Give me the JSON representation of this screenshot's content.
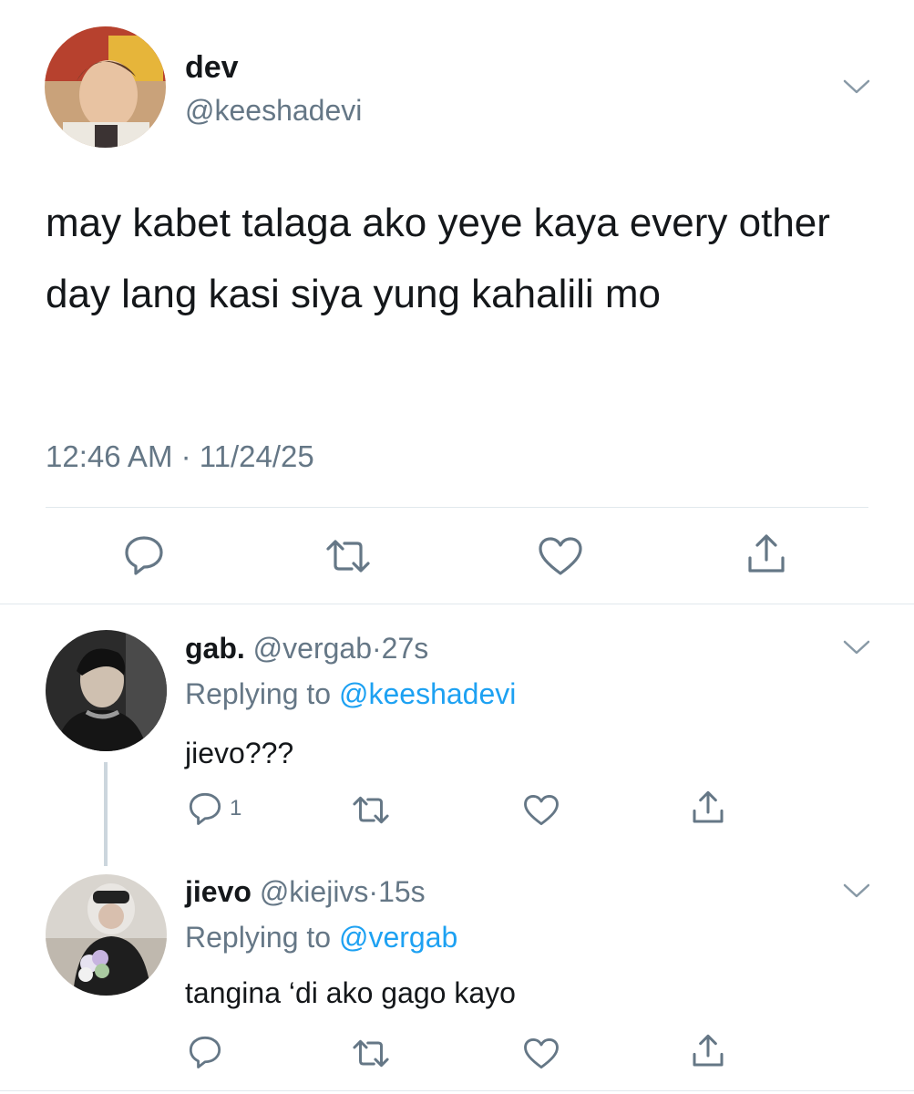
{
  "main_tweet": {
    "name": "dev",
    "handle": "@keeshadevi",
    "text": "may kabet talaga ako yeye kaya every other day lang kasi siya yung kahalili mo",
    "timestamp": "12:46 AM · 11/24/25",
    "actions": [
      "reply-icon",
      "retweet-icon",
      "like-icon",
      "share-icon"
    ]
  },
  "replies": [
    {
      "name": "gab.",
      "handle": "@vergab",
      "dot": "·",
      "time": "27s",
      "replying_label": "Replying to",
      "replying_to": "@keeshadevi",
      "text": "jievo???",
      "reply_count": "1"
    },
    {
      "name": "jievo",
      "handle": "@kiejivs",
      "dot": "·",
      "time": "15s",
      "replying_label": "Replying to",
      "replying_to": "@vergab",
      "text": "tangina ‘di ako gago kayo",
      "reply_count": ""
    }
  ],
  "colors": {
    "text": "#14171a",
    "secondary": "#657786",
    "link": "#1da1f2",
    "divider": "#e1e8ed",
    "icon": "#657786"
  }
}
